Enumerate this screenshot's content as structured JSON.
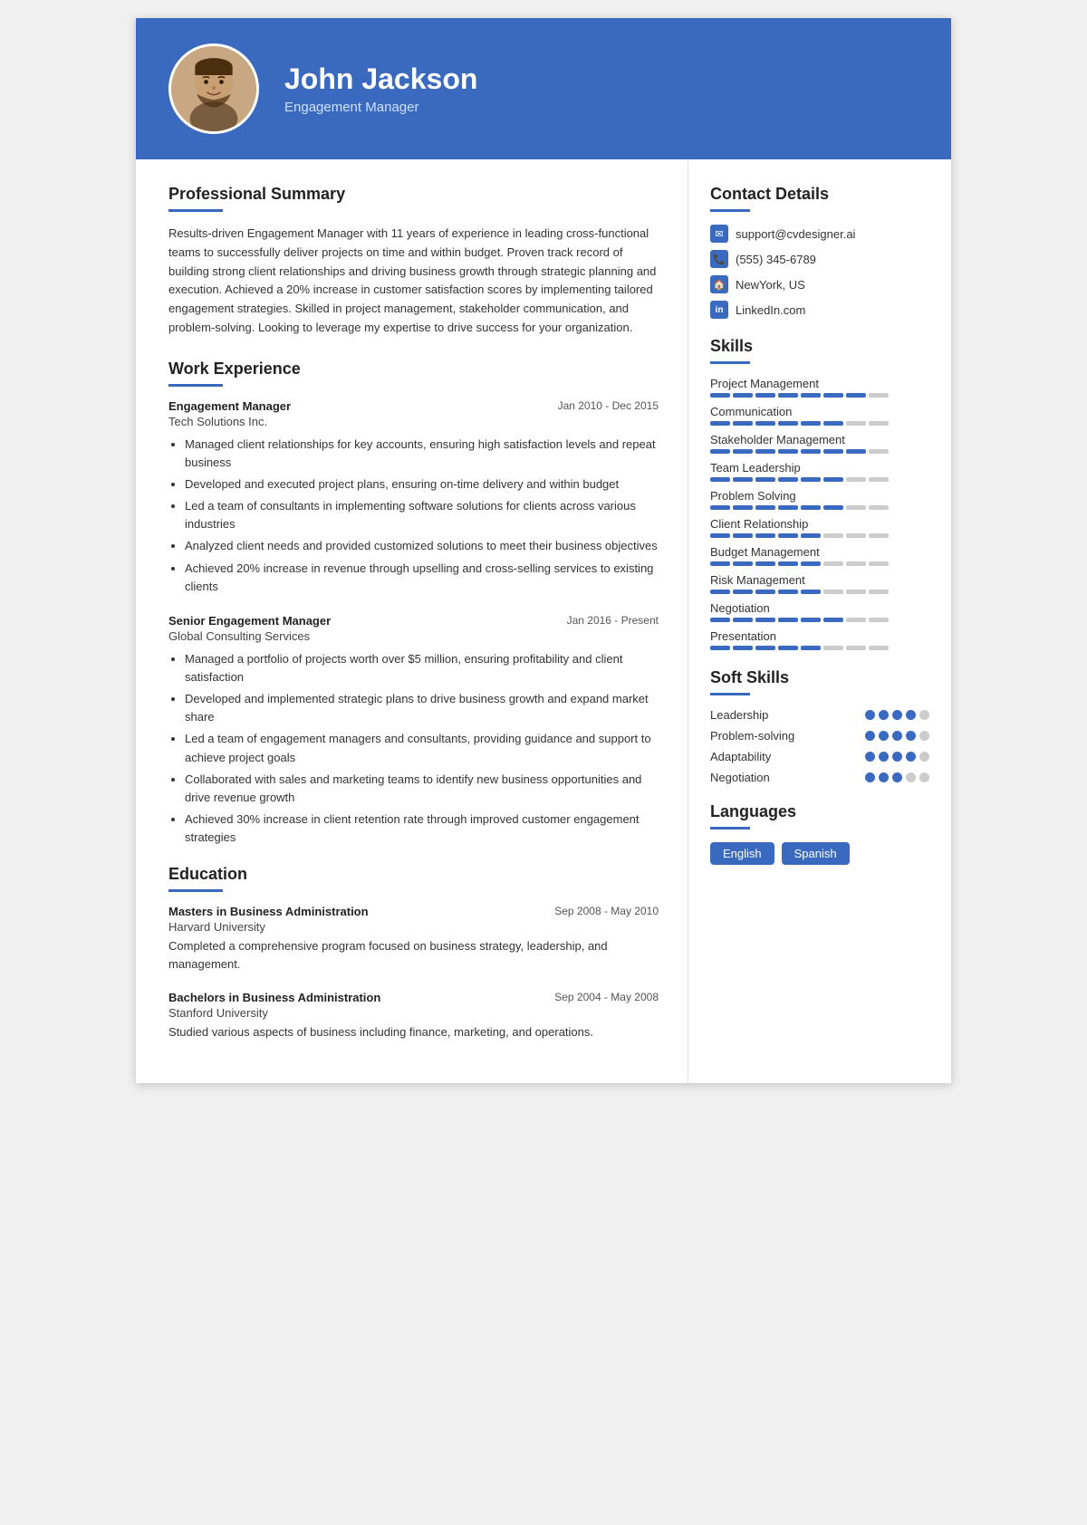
{
  "header": {
    "name": "John Jackson",
    "title": "Engagement Manager",
    "avatar_label": "profile photo"
  },
  "summary": {
    "section_title": "Professional Summary",
    "text": "Results-driven Engagement Manager with 11 years of experience in leading cross-functional teams to successfully deliver projects on time and within budget. Proven track record of building strong client relationships and driving business growth through strategic planning and execution. Achieved a 20% increase in customer satisfaction scores by implementing tailored engagement strategies. Skilled in project management, stakeholder communication, and problem-solving. Looking to leverage my expertise to drive success for your organization."
  },
  "work": {
    "section_title": "Work Experience",
    "jobs": [
      {
        "title": "Engagement Manager",
        "company": "Tech Solutions Inc.",
        "date": "Jan 2010 - Dec 2015",
        "bullets": [
          "Managed client relationships for key accounts, ensuring high satisfaction levels and repeat business",
          "Developed and executed project plans, ensuring on-time delivery and within budget",
          "Led a team of consultants in implementing software solutions for clients across various industries",
          "Analyzed client needs and provided customized solutions to meet their business objectives",
          "Achieved 20% increase in revenue through upselling and cross-selling services to existing clients"
        ]
      },
      {
        "title": "Senior Engagement Manager",
        "company": "Global Consulting Services",
        "date": "Jan 2016 - Present",
        "bullets": [
          "Managed a portfolio of projects worth over $5 million, ensuring profitability and client satisfaction",
          "Developed and implemented strategic plans to drive business growth and expand market share",
          "Led a team of engagement managers and consultants, providing guidance and support to achieve project goals",
          "Collaborated with sales and marketing teams to identify new business opportunities and drive revenue growth",
          "Achieved 30% increase in client retention rate through improved customer engagement strategies"
        ]
      }
    ]
  },
  "education": {
    "section_title": "Education",
    "items": [
      {
        "degree": "Masters in Business Administration",
        "school": "Harvard University",
        "date": "Sep 2008 - May 2010",
        "desc": "Completed a comprehensive program focused on business strategy, leadership, and management."
      },
      {
        "degree": "Bachelors in Business Administration",
        "school": "Stanford University",
        "date": "Sep 2004 - May 2008",
        "desc": "Studied various aspects of business including finance, marketing, and operations."
      }
    ]
  },
  "contact": {
    "section_title": "Contact Details",
    "items": [
      {
        "icon": "✉",
        "value": "support@cvdesigner.ai",
        "type": "email"
      },
      {
        "icon": "📞",
        "value": "(555) 345-6789",
        "type": "phone"
      },
      {
        "icon": "🏠",
        "value": "NewYork, US",
        "type": "address"
      },
      {
        "icon": "in",
        "value": "LinkedIn.com",
        "type": "linkedin"
      }
    ]
  },
  "skills": {
    "section_title": "Skills",
    "items": [
      {
        "name": "Project Management",
        "filled": 7,
        "total": 8
      },
      {
        "name": "Communication",
        "filled": 6,
        "total": 8
      },
      {
        "name": "Stakeholder Management",
        "filled": 7,
        "total": 8
      },
      {
        "name": "Team Leadership",
        "filled": 6,
        "total": 8
      },
      {
        "name": "Problem Solving",
        "filled": 6,
        "total": 8
      },
      {
        "name": "Client Relationship",
        "filled": 5,
        "total": 8
      },
      {
        "name": "Budget Management",
        "filled": 5,
        "total": 8
      },
      {
        "name": "Risk Management",
        "filled": 5,
        "total": 8
      },
      {
        "name": "Negotiation",
        "filled": 6,
        "total": 8
      },
      {
        "name": "Presentation",
        "filled": 5,
        "total": 8
      }
    ]
  },
  "soft_skills": {
    "section_title": "Soft Skills",
    "items": [
      {
        "name": "Leadership",
        "filled": 4,
        "total": 5
      },
      {
        "name": "Problem-solving",
        "filled": 4,
        "total": 5
      },
      {
        "name": "Adaptability",
        "filled": 4,
        "total": 5
      },
      {
        "name": "Negotiation",
        "filled": 3,
        "total": 5
      }
    ]
  },
  "languages": {
    "section_title": "Languages",
    "items": [
      "English",
      "Spanish"
    ]
  },
  "colors": {
    "accent": "#3a6abf"
  }
}
